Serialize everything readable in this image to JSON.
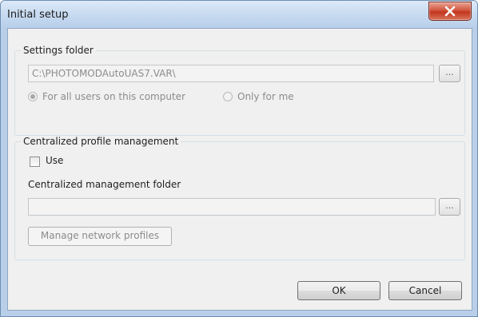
{
  "window": {
    "title": "Initial setup",
    "close_icon": "close-x-icon"
  },
  "settings_folder": {
    "legend": "Settings folder",
    "path_value": "C:\\PHOTOMODAutoUAS7.VAR\\",
    "browse_label": "...",
    "options": [
      {
        "label": "For all users on this computer",
        "checked": true
      },
      {
        "label": "Only for me",
        "checked": false
      }
    ]
  },
  "centralized": {
    "legend": "Centralized profile management",
    "use_label": "Use",
    "use_checked": false,
    "folder_label": "Centralized management folder",
    "folder_value": "",
    "browse_label": "...",
    "manage_label": "Manage network profiles"
  },
  "buttons": {
    "ok": "OK",
    "cancel": "Cancel"
  }
}
